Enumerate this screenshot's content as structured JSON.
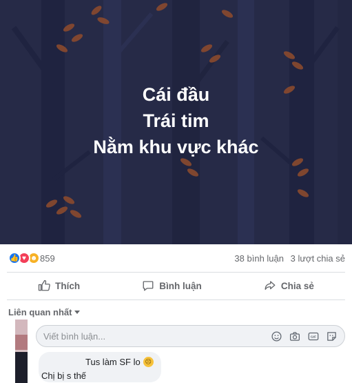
{
  "post": {
    "caption_lines": [
      "Cái đầu",
      "Trái tim",
      "Nằm khu vực khác"
    ]
  },
  "stats": {
    "reaction_count": "859",
    "reaction_icons": [
      "like-icon",
      "love-icon",
      "haha-icon"
    ],
    "comments": "38 bình luận",
    "shares": "3 lượt chia sẻ"
  },
  "actions": {
    "like": "Thích",
    "comment": "Bình luận",
    "share": "Chia sẻ"
  },
  "comments": {
    "sort_label": "Liên quan nhất",
    "composer_placeholder": "Viết bình luận...",
    "composer_icons": [
      "emoji-icon",
      "camera-icon",
      "gif-icon",
      "sticker-icon"
    ],
    "items": [
      {
        "text": "Tus làm SF lo",
        "reply_preview": "Chị bị s thế"
      }
    ]
  },
  "colors": {
    "image_bg": "#262a47",
    "leaf": "#8a4a2e",
    "like_blue": "#1877f2",
    "love_red": "#f33e58",
    "haha_yellow": "#f7b125"
  }
}
